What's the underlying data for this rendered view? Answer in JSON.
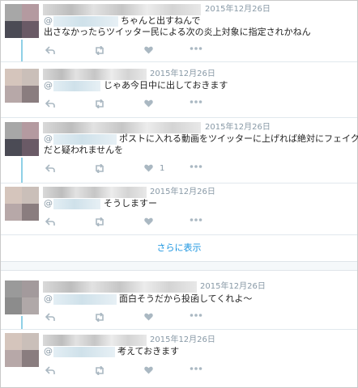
{
  "tweets": [
    {
      "date": "2015年12月26日",
      "mention_prefix": "@",
      "text_line1": "ちゃんと出すねんで",
      "text_line2": "出さなかったらツイッター民による次の炎上対象に指定されかねん",
      "likes": ""
    },
    {
      "date": "2015年12月26日",
      "mention_prefix": "@",
      "text_line1": "じゃあ今日中に出しておきます",
      "text_line2": "",
      "likes": ""
    },
    {
      "date": "2015年12月26日",
      "mention_prefix": "@",
      "text_line1": "ポストに入れる動画をツイッターに上げれば絶対にフェイク",
      "text_line2": "だと疑われませんを",
      "likes": "1"
    },
    {
      "date": "2015年12月26日",
      "mention_prefix": "@",
      "text_line1": "そうしますー",
      "text_line2": "",
      "likes": ""
    },
    {
      "date": "2015年12月26日",
      "mention_prefix": "@",
      "text_line1": "面白そうだから投函してくれよ～",
      "text_line2": "",
      "likes": ""
    },
    {
      "date": "2015年12月26日",
      "mention_prefix": "@",
      "text_line1": "考えておきます",
      "text_line2": "",
      "likes": ""
    }
  ],
  "show_more_label": "さらに表示",
  "icons": {
    "reply": "reply-icon",
    "retweet": "retweet-icon",
    "like": "heart-icon",
    "more": "more-icon"
  },
  "colors": {
    "link": "#1b95e0",
    "meta": "#8899a6",
    "icon": "#aab8c2",
    "thread": "#8fd0e6"
  }
}
